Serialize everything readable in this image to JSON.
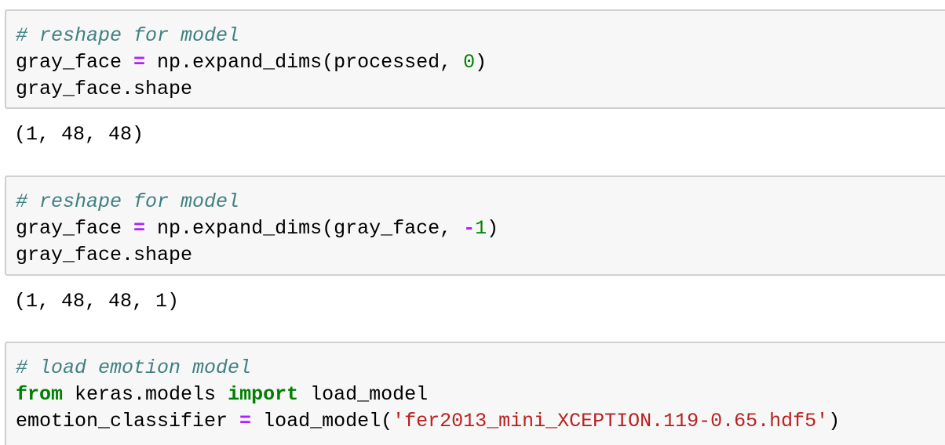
{
  "cells": [
    {
      "comment": "# reshape for model",
      "line2": {
        "var": "gray_face ",
        "op": "=",
        "call": " np.expand_dims(processed, ",
        "num": "0",
        "close": ")"
      },
      "line3": "gray_face.shape",
      "output": "(1, 48, 48)"
    },
    {
      "comment": "# reshape for model",
      "line2": {
        "var": "gray_face ",
        "op": "=",
        "call": " np.expand_dims(gray_face, ",
        "neg": "-",
        "num": "1",
        "close": ")"
      },
      "line3": "gray_face.shape",
      "output": "(1, 48, 48, 1)"
    },
    {
      "comment": "# load emotion model",
      "line2": {
        "kw_from": "from",
        "module": " keras.models ",
        "kw_import": "import",
        "name": " load_model"
      },
      "line3": {
        "var": "emotion_classifier ",
        "op": "=",
        "call": " load_model(",
        "str": "'fer2013_mini_XCEPTION.119-0.65.hdf5'",
        "close": ")"
      }
    }
  ],
  "colors": {
    "comment": "#408080",
    "operator": "#aa22ff",
    "number": "#008000",
    "keyword": "#008000",
    "string": "#ba2121",
    "cell_bg": "#f7f7f7",
    "cell_border": "#cfcfcf"
  }
}
